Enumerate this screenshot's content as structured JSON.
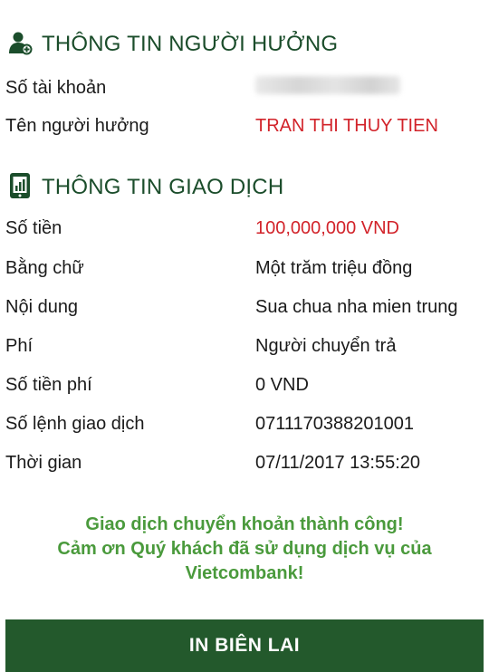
{
  "beneficiary": {
    "heading": "THÔNG TIN NGƯỜI HƯỞNG",
    "icon": "user-icon",
    "rows": [
      {
        "label": "Số tài khoản",
        "value": ""
      },
      {
        "label": "Tên người hưởng",
        "value": "TRAN THI THUY TIEN"
      }
    ]
  },
  "transaction": {
    "heading": "THÔNG TIN GIAO DỊCH",
    "icon": "phone-icon",
    "rows": [
      {
        "label": "Số tiền",
        "value": "100,000,000 VND"
      },
      {
        "label": "Bằng chữ",
        "value": "Một trăm triệu đồng"
      },
      {
        "label": "Nội dung",
        "value": "Sua chua nha mien trung"
      },
      {
        "label": "Phí",
        "value": "Người chuyển trả"
      },
      {
        "label": "Số tiền phí",
        "value": "0 VND"
      },
      {
        "label": "Số lệnh giao dịch",
        "value": "0711170388201001"
      },
      {
        "label": "Thời gian",
        "value": "07/11/2017 13:55:20"
      }
    ]
  },
  "success_message": {
    "line1": "Giao dịch chuyển khoản thành công!",
    "line2": "Cảm ơn Quý khách đã sử dụng dịch vụ của",
    "line3": "Vietcombank!"
  },
  "print_button": {
    "label": "IN BIÊN LAI"
  },
  "colors": {
    "brand_green": "#23592c",
    "heading_green": "#1b4d2b",
    "highlight_red": "#d2232a",
    "success_green": "#4a9a3c"
  }
}
